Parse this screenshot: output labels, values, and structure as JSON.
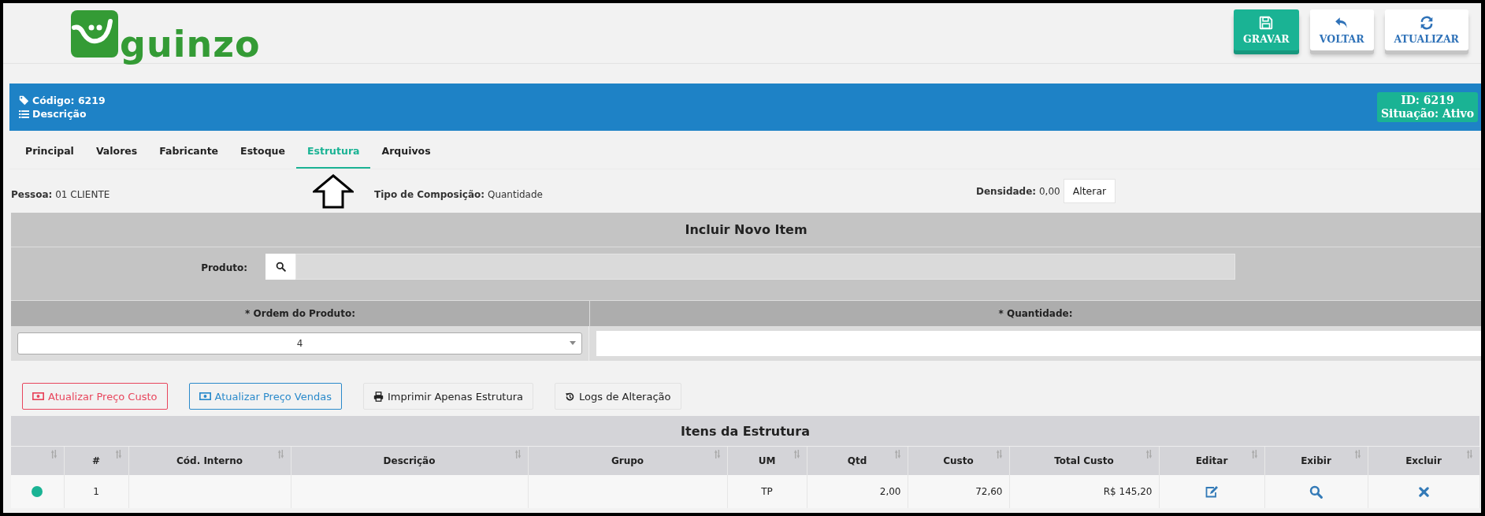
{
  "header": {
    "logo": "guinzo",
    "buttons": [
      {
        "label": "GRAVAR",
        "kind": "primary"
      },
      {
        "label": "VOLTAR",
        "kind": "default"
      },
      {
        "label": "ATUALIZAR",
        "kind": "default"
      }
    ]
  },
  "record": {
    "code": "Código: 6219",
    "description": "Descrição",
    "id": "ID: 6219",
    "status": "Situação: Ativo"
  },
  "tabs": [
    {
      "label": "Principal",
      "selected": false
    },
    {
      "label": "Valores",
      "selected": false
    },
    {
      "label": "Fabricante",
      "selected": false
    },
    {
      "label": "Estoque",
      "selected": false
    },
    {
      "label": "Estrutura",
      "selected": true
    },
    {
      "label": "Arquivos",
      "selected": false
    }
  ],
  "info": [
    {
      "label": "Pessoa:",
      "value": "01 CLIENTE"
    },
    {
      "label": "Tipo de Composição:",
      "value": "Quantidade"
    },
    {
      "label": "Densidade:",
      "value": "0,00",
      "button": "Alterar"
    }
  ],
  "new_item": {
    "title": "Incluir Novo Item",
    "product_label": "Produto:",
    "order_label": "* Ordem do Produto:",
    "order_value": "4",
    "quantity_label": "* Quantidade:"
  },
  "actions": [
    {
      "label": "Atualizar Preço Custo",
      "kind": "danger"
    },
    {
      "label": "Atualizar Preço Vendas",
      "kind": "info"
    },
    {
      "label": "Imprimir Apenas Estrutura",
      "kind": "default"
    },
    {
      "label": "Logs de Alteração",
      "kind": "default"
    }
  ],
  "table": {
    "title": "Itens da Estrutura",
    "columns": [
      {
        "sortable": true
      },
      {
        "label": "#",
        "sortable": true
      },
      {
        "label": "Cód. Interno",
        "sortable": true
      },
      {
        "label": "Descrição",
        "sortable": true
      },
      {
        "label": "Grupo",
        "sortable": true
      },
      {
        "label": "UM",
        "sortable": true
      },
      {
        "label": "Qtd",
        "sortable": true
      },
      {
        "label": "Custo",
        "sortable": true
      },
      {
        "label": "Total Custo",
        "sortable": true
      },
      {
        "label": "Editar",
        "sortable": true
      },
      {
        "label": "Exibir",
        "sortable": true
      },
      {
        "label": "Excluir",
        "sortable": true
      }
    ],
    "rows": [
      {
        "color": "#1ab394",
        "number": "1",
        "um": "TP",
        "qtd": "2,00",
        "custo": "72,60",
        "total": "R$ 145,20"
      }
    ]
  }
}
